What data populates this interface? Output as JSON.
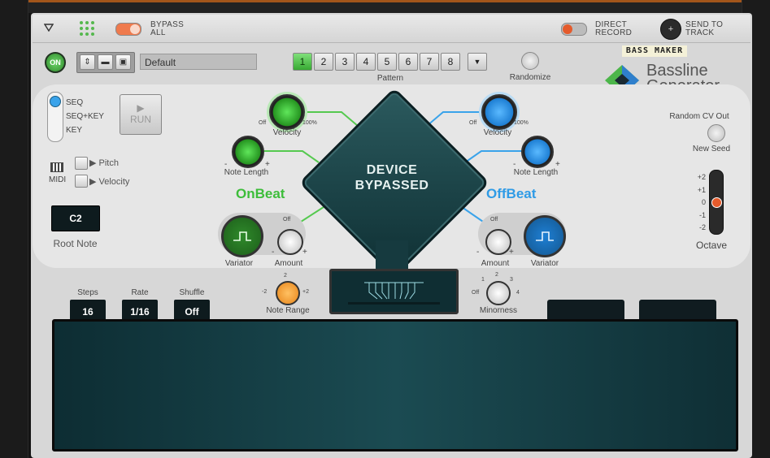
{
  "header": {
    "menu_icon": "triangle-down-icon",
    "bypass_label_line1": "BYPASS",
    "bypass_label_line2": "ALL",
    "direct_label_line1": "DIRECT",
    "direct_label_line2": "RECORD",
    "send_label_line1": "SEND TO",
    "send_label_line2": "TRACK"
  },
  "toolbar": {
    "power_label": "ON",
    "preset_name": "Default",
    "pattern_buttons": [
      "1",
      "2",
      "3",
      "4",
      "5",
      "6",
      "7",
      "8"
    ],
    "active_pattern": "1",
    "pattern_dropdown": "▼",
    "pattern_label": "Pattern",
    "randomize_label": "Randomize"
  },
  "brand": {
    "tag": "BASS MAKER",
    "line1": "Bassline",
    "line2": "Generator"
  },
  "left": {
    "mode_options": [
      "SEQ",
      "SEQ+KEY",
      "KEY"
    ],
    "run_label": "RUN",
    "midi_label": "MIDI",
    "pitch_label": "Pitch",
    "velocity_label": "Velocity",
    "root_note_value": "C2",
    "root_note_label": "Root Note"
  },
  "onbeat": {
    "title": "OnBeat",
    "velocity_label": "Velocity",
    "velocity_min": "Off",
    "velocity_max": "100%",
    "note_length_label": "Note Length",
    "minus": "-",
    "plus": "+",
    "variator_label": "Variator",
    "amount_label": "Amount",
    "amount_min": "-",
    "amount_off": "Off",
    "amount_plus": "+",
    "note_range_label": "Note Range",
    "note_range_marks": [
      "-2",
      "2",
      "+2"
    ]
  },
  "offbeat": {
    "title": "OffBeat",
    "velocity_label": "Velocity",
    "velocity_min": "Off",
    "velocity_max": "100%",
    "note_length_label": "Note Length",
    "minus": "-",
    "plus": "+",
    "variator_label": "Variator",
    "amount_label": "Amount",
    "amount_off": "Off",
    "amount_minus": "-",
    "amount_plus": "+",
    "minorness_label": "Minorness",
    "minorness_marks": [
      "Off",
      "1",
      "2",
      "3",
      "4"
    ]
  },
  "center": {
    "line1": "DEVICE",
    "line2": "BYPASSED"
  },
  "right": {
    "random_cv_label": "Random CV Out",
    "new_seed_label": "New Seed",
    "octave_marks": [
      "+2",
      "+1",
      "0",
      "-1",
      "-2"
    ],
    "octave_label": "Octave"
  },
  "sequencer": {
    "steps_label": "Steps",
    "steps_value": "16",
    "rate_label": "Rate",
    "rate_value": "1/16",
    "shuffle_label": "Shuffle",
    "shuffle_value": "Off"
  },
  "colors": {
    "green": "#4cc04a",
    "blue": "#39a6f0",
    "orange": "#f39a23",
    "accent_red": "#e55b2c",
    "onbeat_text": "#3dbd3a",
    "offbeat_text": "#2f9be6"
  }
}
